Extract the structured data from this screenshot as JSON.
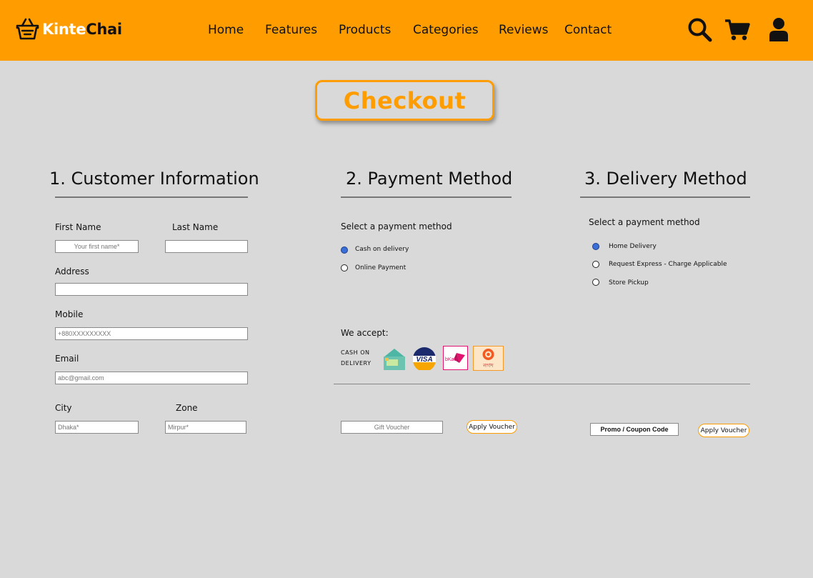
{
  "header": {
    "logo_part1": "Kinte",
    "logo_part2": "Chai",
    "nav": [
      "Home",
      "Features",
      "Products",
      "Categories",
      "Reviews",
      "Contact"
    ],
    "icons": [
      "search-icon",
      "cart-icon",
      "user-icon"
    ]
  },
  "page_title": "Checkout",
  "customer": {
    "title": "1. Customer Information",
    "first_name_label": "First Name",
    "first_name_placeholder": "Your first name*",
    "last_name_label": "Last Name",
    "address_label": "Address",
    "mobile_label": "Mobile",
    "mobile_placeholder": "+880XXXXXXXXX",
    "email_label": "Email",
    "email_placeholder": "abc@gmail.com",
    "city_label": "City",
    "city_placeholder": "Dhaka*",
    "zone_label": "Zone",
    "zone_placeholder": "Mirpur*"
  },
  "payment": {
    "title": "2. Payment Method",
    "select_label": "Select a payment method",
    "options": [
      "Cash on delivery",
      "Online Payment"
    ],
    "selected": 0,
    "we_accept_label": "We accept:",
    "cod_line1": "CASH ON",
    "cod_line2": "DELIVERY",
    "logos": [
      "cash-on-delivery-icon",
      "visa-icon",
      "bkash-icon",
      "nagad-icon"
    ],
    "visa_text": "VISA",
    "bkash_text": "bKash",
    "nagad_text": "নগদ",
    "gift_voucher_placeholder": "Gift Voucher",
    "apply_voucher_label": "Apply Voucher"
  },
  "delivery": {
    "title": "3. Delivery Method",
    "select_label": "Select a payment method",
    "options": [
      "Home Delivery",
      "Request Express - Charge Applicable",
      "Store Pickup"
    ],
    "selected": 0,
    "promo_placeholder": "Promo / Coupon Code",
    "apply_voucher_label": "Apply Voucher"
  },
  "colors": {
    "accent": "#ff9d00",
    "background": "#d9d9d9",
    "radio_selected": "#3a6fd8"
  }
}
